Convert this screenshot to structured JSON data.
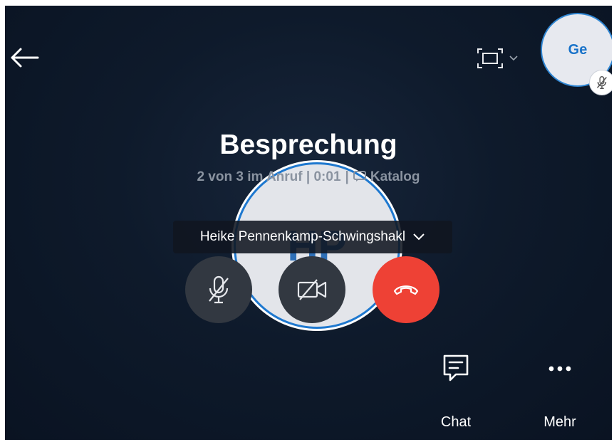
{
  "call": {
    "title": "Besprechung",
    "subtitle_status": "2 von 3 im Anruf | 0:01",
    "subtitle_separator": "|",
    "subtitle_category": "Katalog"
  },
  "self": {
    "initials": "Ge",
    "muted": true
  },
  "participant": {
    "initials": "HP",
    "name": "Heike Pennenkamp-Schwingshakl"
  },
  "controls": {
    "mic": "mic-muted-icon",
    "camera": "camera-off-icon",
    "hangup": "hangup-icon"
  },
  "actions": {
    "chat_label": "Chat",
    "more_label": "Mehr"
  },
  "colors": {
    "background": "#0e1a2b",
    "accent": "#1e78cf",
    "hangup": "#ee4135",
    "control": "#323841"
  }
}
